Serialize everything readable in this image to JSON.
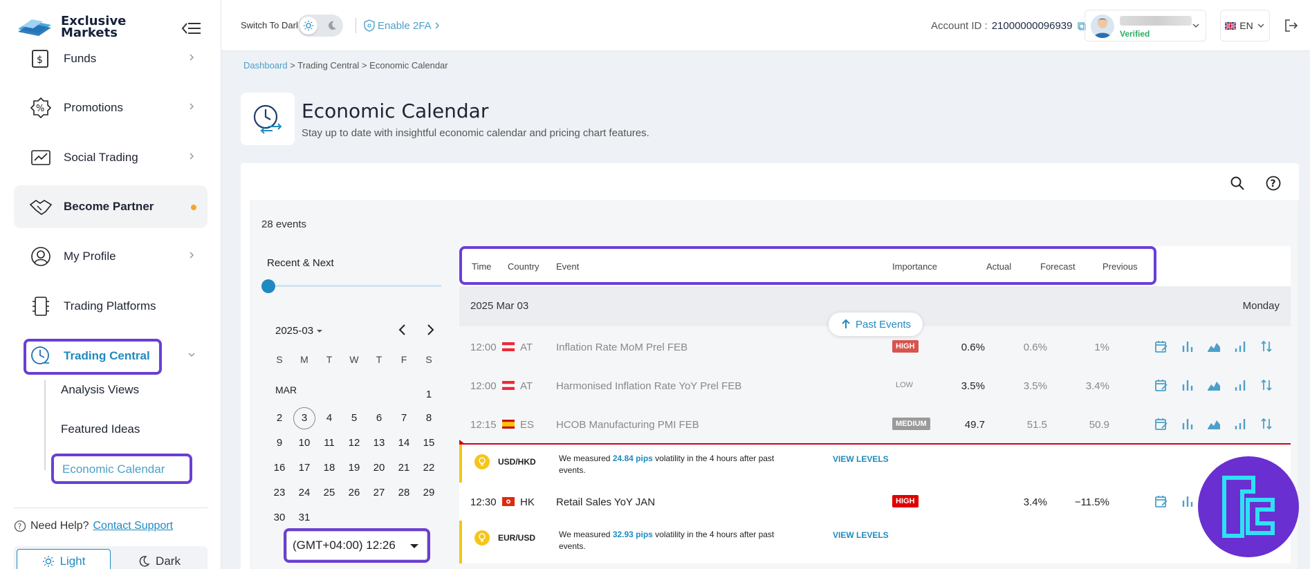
{
  "brand": {
    "logo_line1": "Exclusive",
    "logo_line2": "Markets"
  },
  "sidebar": {
    "items": [
      {
        "label": "Funds",
        "icon": "funds-icon"
      },
      {
        "label": "Promotions",
        "icon": "percent-icon"
      },
      {
        "label": "Social Trading",
        "icon": "social-trading-icon"
      },
      {
        "label": "Become Partner",
        "icon": "handshake-icon"
      },
      {
        "label": "My Profile",
        "icon": "user-icon"
      },
      {
        "label": "Trading Platforms",
        "icon": "platforms-icon"
      },
      {
        "label": "Trading Central",
        "icon": "clock-chart-icon"
      }
    ],
    "sub_items": [
      "Analysis Views",
      "Featured Ideas",
      "Economic Calendar"
    ],
    "help_text": "Need Help?",
    "help_link": "Contact Support",
    "theme_light": "Light",
    "theme_dark": "Dark"
  },
  "topbar": {
    "dark_label": "Switch To Dark",
    "twofa_label": "Enable 2FA",
    "account_label": "Account ID :",
    "account_id": "21000000096939",
    "verified": "Verified",
    "lang": "EN"
  },
  "page": {
    "breadcrumb": [
      "Dashboard",
      "Trading Central",
      "Economic Calendar"
    ],
    "title": "Economic Calendar",
    "subtitle": "Stay up to date with insightful economic calendar and pricing chart features."
  },
  "calendar": {
    "events_count": "28 events",
    "range_label": "Recent & Next",
    "month_select": "2025-03",
    "dow": [
      "S",
      "M",
      "T",
      "W",
      "T",
      "F",
      "S"
    ],
    "month_label": "MAR",
    "days": [
      "1",
      "2",
      "3",
      "4",
      "5",
      "6",
      "7",
      "8",
      "9",
      "10",
      "11",
      "12",
      "13",
      "14",
      "15",
      "16",
      "17",
      "18",
      "19",
      "20",
      "21",
      "22",
      "23",
      "24",
      "25",
      "26",
      "27",
      "28",
      "29",
      "30",
      "31"
    ],
    "today": "3",
    "timezone": "(GMT+04:00) 12:26"
  },
  "table": {
    "headers": [
      "Time",
      "Country",
      "Event",
      "Importance",
      "Actual",
      "Forecast",
      "Previous"
    ],
    "date": "2025 Mar 03",
    "weekday": "Monday",
    "past_events": "Past Events",
    "rows": [
      {
        "time": "12:00",
        "country": "AT",
        "event": "Inflation Rate MoM Prel FEB",
        "importance": "HIGH",
        "actual": "0.6%",
        "forecast": "0.6%",
        "previous": "1%"
      },
      {
        "time": "12:00",
        "country": "AT",
        "event": "Harmonised Inflation Rate YoY Prel FEB",
        "importance": "LOW",
        "actual": "3.5%",
        "forecast": "3.5%",
        "previous": "3.4%"
      },
      {
        "time": "12:15",
        "country": "ES",
        "event": "HCOB Manufacturing PMI FEB",
        "importance": "MEDIUM",
        "actual": "49.7",
        "forecast": "51.5",
        "previous": "50.9"
      },
      {
        "time": "12:30",
        "country": "HK",
        "event": "Retail Sales YoY JAN",
        "importance": "HIGH",
        "actual": "",
        "forecast": "3.4%",
        "previous": "−11.5%"
      }
    ],
    "volatility": [
      {
        "pair": "USD/HKD",
        "pre": "We measured ",
        "pips": "24.84 pips",
        "post": " volatility in the 4 hours after past events.",
        "link": "VIEW LEVELS"
      },
      {
        "pair": "EUR/USD",
        "pre": "We measured ",
        "pips": "32.93 pips",
        "post": " volatility in the 4 hours after past events.",
        "link": "VIEW LEVELS"
      }
    ]
  },
  "colors": {
    "accent": "#1f8ac0",
    "highlight": "#6a3fd4",
    "high": "#d9534f",
    "now_line": "#d0021b",
    "vol_bar": "#f5c518"
  }
}
